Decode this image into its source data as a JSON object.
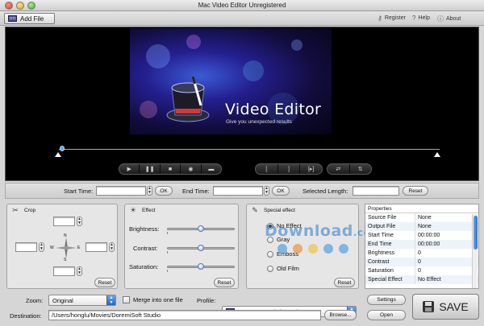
{
  "window": {
    "title": "Mac Video Editor Unregistered"
  },
  "toolbar": {
    "add_file": "Add File",
    "register": "Register",
    "help": "Help",
    "about": "About"
  },
  "preview": {
    "logo_title": "Video Editor",
    "logo_subtitle": "Give you unexpected results"
  },
  "time_row": {
    "start_label": "Start Time:",
    "end_label": "End Time:",
    "selected_label": "Selected Length:",
    "ok": "OK",
    "reset": "Reset",
    "start_value": "",
    "end_value": "",
    "selected_value": ""
  },
  "crop": {
    "title": "Crop",
    "compass": {
      "n": "N",
      "s": "S",
      "w": "W",
      "e": "E"
    },
    "reset": "Reset"
  },
  "effect": {
    "title": "Effect",
    "reset": "Reset",
    "sliders": [
      {
        "label": "Brightness:",
        "value": 0.5
      },
      {
        "label": "Contrast:",
        "value": 0.5
      },
      {
        "label": "Saturation:",
        "value": 0.5
      }
    ]
  },
  "special_effect": {
    "title": "Special effect",
    "reset": "Reset",
    "options": [
      "No Effect",
      "Gray",
      "Emboss",
      "Old Film"
    ],
    "selected": "No Effect"
  },
  "properties": {
    "title": "Properties",
    "rows": [
      {
        "key": "Source File",
        "value": "None"
      },
      {
        "key": "Output File",
        "value": "None"
      },
      {
        "key": "Start Time",
        "value": "00:00:00"
      },
      {
        "key": "End Time",
        "value": "00:00:00"
      },
      {
        "key": "Brightness",
        "value": "0"
      },
      {
        "key": "Contrast",
        "value": "0"
      },
      {
        "key": "Saturation",
        "value": "0"
      },
      {
        "key": "Special Effect",
        "value": "No Effect"
      }
    ]
  },
  "bottom": {
    "zoom_label": "Zoom:",
    "zoom_value": "Original",
    "merge_label": "Merge into one file",
    "profile_label": "Profile:",
    "profile_value": "MPEG-4 Movie(*.mp4)",
    "destination_label": "Destination:",
    "destination_value": "/Users/honglu/Movies/DoremiSoft Studio",
    "browse": "Browse...",
    "settings": "Settings",
    "open": "Open",
    "save": "SAVE"
  },
  "watermark": {
    "text": "Download",
    "suffix": ".com.vn"
  },
  "colors": {
    "preview_bg": "#000000",
    "accent_blue": "#2a66c0"
  }
}
